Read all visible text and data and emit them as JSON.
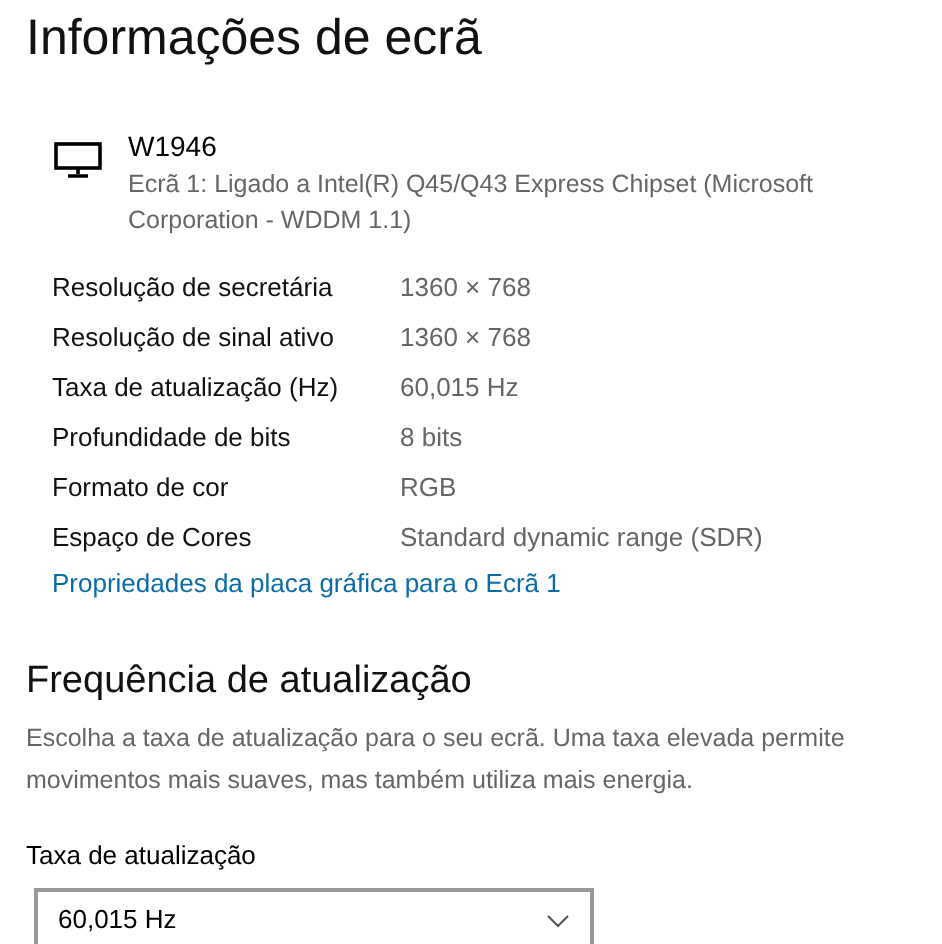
{
  "title": "Informações de ecrã",
  "display": {
    "name": "W1946",
    "detail": "Ecrã 1: Ligado a Intel(R) Q45/Q43 Express Chipset (Microsoft Corporation - WDDM 1.1)"
  },
  "properties": [
    {
      "label": "Resolução de secretária",
      "value": "1360 × 768"
    },
    {
      "label": "Resolução de sinal ativo",
      "value": "1360 × 768"
    },
    {
      "label": "Taxa de atualização (Hz)",
      "value": "60,015 Hz"
    },
    {
      "label": "Profundidade de bits",
      "value": "8 bits"
    },
    {
      "label": "Formato de cor",
      "value": "RGB"
    },
    {
      "label": "Espaço de Cores",
      "value": "Standard dynamic range (SDR)"
    }
  ],
  "link": "Propriedades da placa gráfica para o Ecrã 1",
  "refresh": {
    "heading": "Frequência de atualização",
    "description": "Escolha a taxa de atualização para o seu ecrã. Uma taxa elevada permite movimentos mais suaves, mas também utiliza mais energia.",
    "label": "Taxa de atualização",
    "value": "60,015 Hz"
  }
}
